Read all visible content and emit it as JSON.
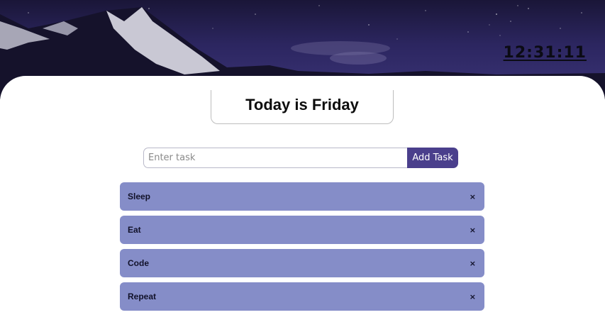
{
  "clock": {
    "time": "12:31:11"
  },
  "header": {
    "title": "Today is Friday"
  },
  "form": {
    "placeholder": "Enter task",
    "value": "",
    "add_label": "Add Task"
  },
  "tasks": [
    {
      "label": "Sleep",
      "remove": "×"
    },
    {
      "label": "Eat",
      "remove": "×"
    },
    {
      "label": "Code",
      "remove": "×"
    },
    {
      "label": "Repeat",
      "remove": "×"
    }
  ],
  "colors": {
    "task_bg": "#858dc8",
    "button_bg": "#4a3f8c",
    "sky": "#2c2660"
  },
  "icons": {
    "remove": "close-icon",
    "background": "mountain-night-sky"
  }
}
